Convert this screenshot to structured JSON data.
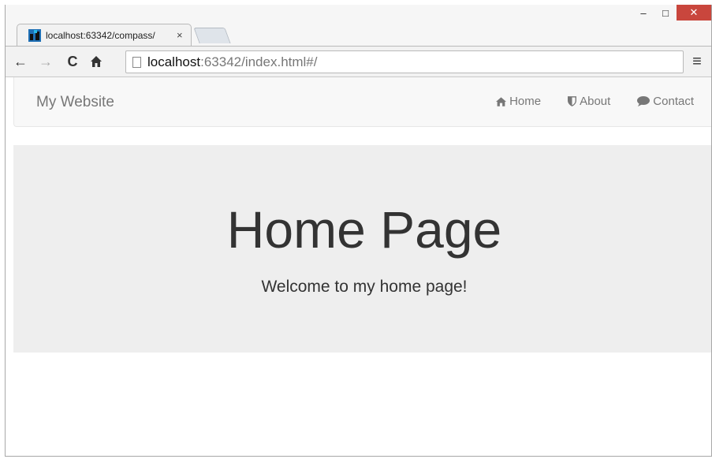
{
  "browser": {
    "tab": {
      "title": "localhost:63342/compass/",
      "close": "×"
    },
    "window_controls": {
      "minimize": "–",
      "maximize": "□",
      "close": "✕"
    },
    "toolbar": {
      "back_icon": "←",
      "forward_icon": "→",
      "reload_icon": "C",
      "home_icon": "home-icon",
      "menu_icon": "≡"
    },
    "omnibox": {
      "host": "localhost",
      "rest": ":63342/index.html#/"
    }
  },
  "page": {
    "navbar": {
      "brand": "My Website",
      "links": [
        {
          "label": "Home",
          "icon": "home-icon"
        },
        {
          "label": "About",
          "icon": "shield-icon"
        },
        {
          "label": "Contact",
          "icon": "comment-icon"
        }
      ]
    },
    "jumbotron": {
      "title": "Home Page",
      "subtitle": "Welcome to my home page!"
    }
  },
  "colors": {
    "close_button": "#c9463d",
    "navbar_bg": "#f8f8f8",
    "jumbotron_bg": "#eeeeee",
    "nav_text": "#777777"
  }
}
